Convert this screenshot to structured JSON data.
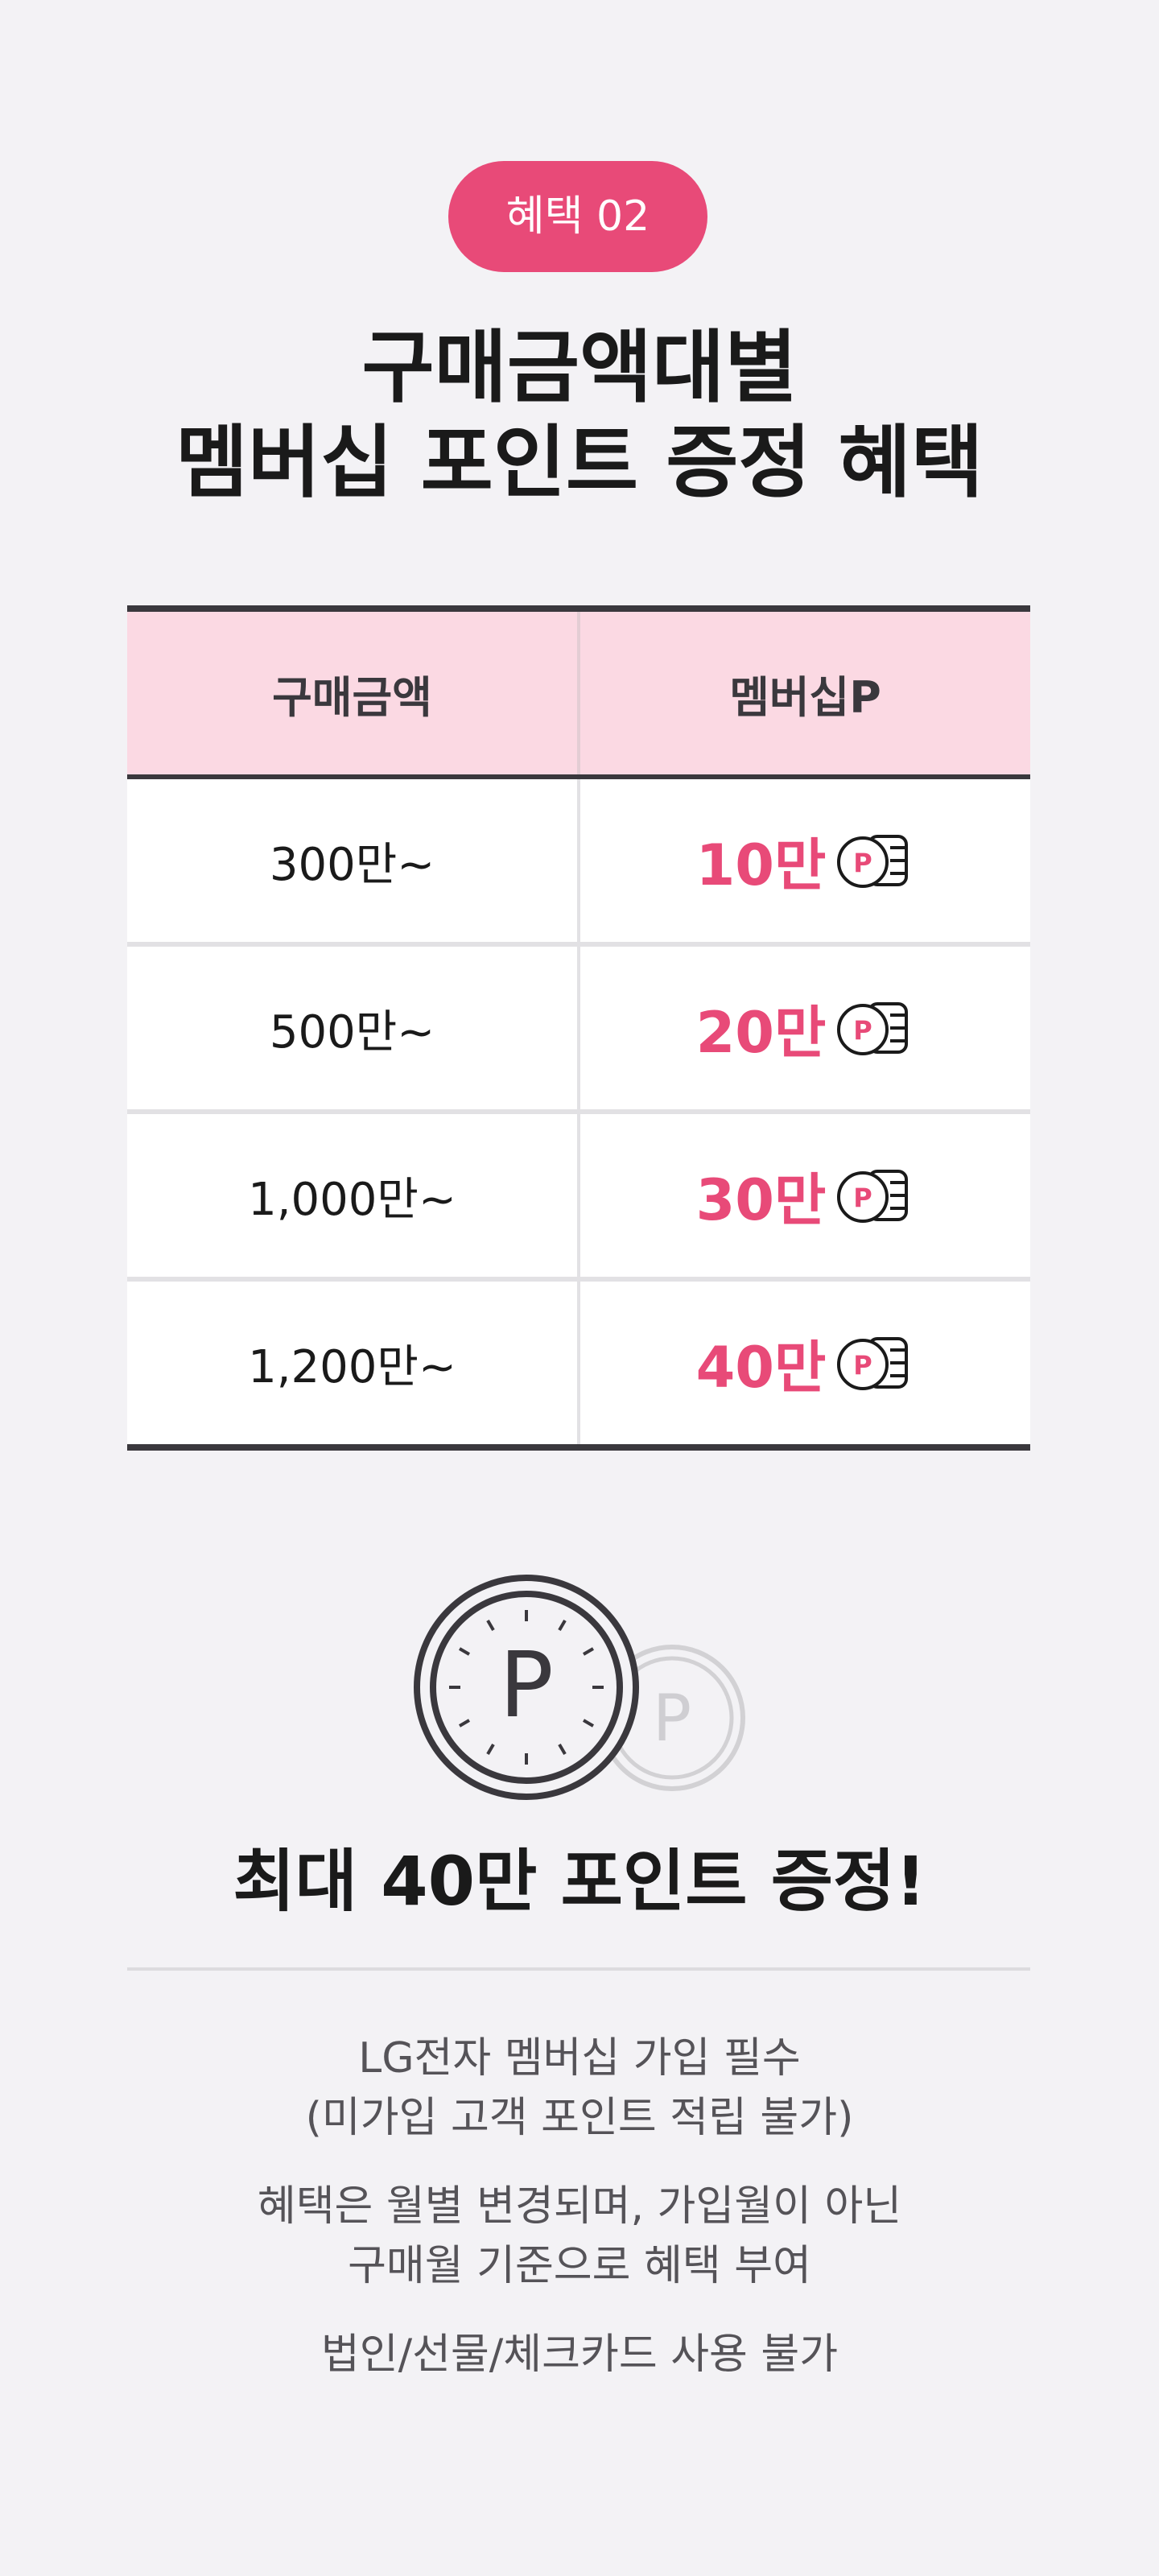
{
  "badge": "혜택 02",
  "headline": {
    "line1": "구매금액대별",
    "line2": "멤버십 포인트 증정 혜택"
  },
  "table": {
    "headers": [
      "구매금액",
      "멤버십P"
    ],
    "rows": [
      {
        "amount": "300만~",
        "points": "10만"
      },
      {
        "amount": "500만~",
        "points": "20만"
      },
      {
        "amount": "1,000만~",
        "points": "30만"
      },
      {
        "amount": "1,200만~",
        "points": "40만"
      }
    ]
  },
  "coin": {
    "symbol": "P"
  },
  "summary": "최대 40만 포인트 증정!",
  "notes": {
    "line1": "LG전자 멤버십 가입 필수",
    "line2": "(미가입 고객 포인트 적립 불가)",
    "line3": "혜택은 월별 변경되며, 가입월이 아닌",
    "line4": "구매월 기준으로 혜택 부여",
    "line5": "법인/선물/체크카드 사용 불가"
  },
  "colors": {
    "accent": "#e84a78",
    "header_bg": "#fbd9e3",
    "background": "#f3f2f5",
    "dark": "#3a383d"
  }
}
